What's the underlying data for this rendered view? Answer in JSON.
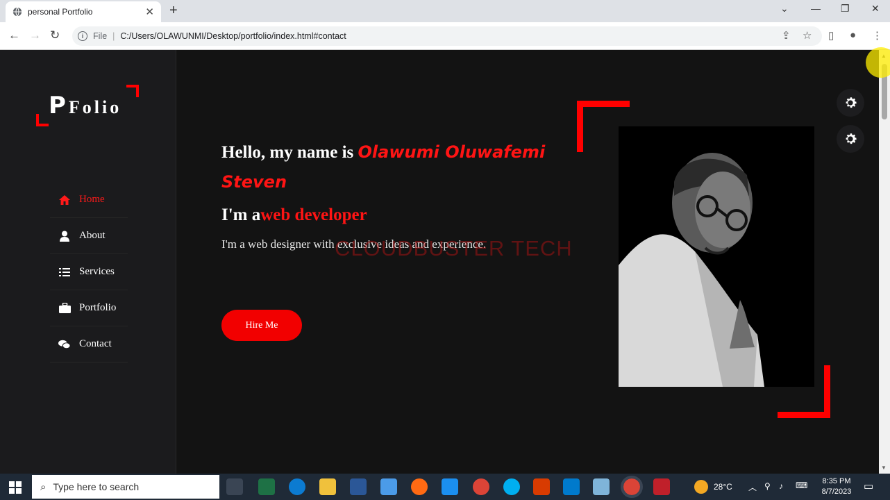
{
  "browser": {
    "tab_title": "personal Portfolio",
    "new_tab": "+",
    "address_scheme": "File",
    "address_url": "C:/Users/OLAWUNMI/Desktop/portfolio/index.html#contact"
  },
  "logo": {
    "initial": "P",
    "rest": "Folio"
  },
  "nav": [
    {
      "label": "Home",
      "icon": "home-icon",
      "active": true
    },
    {
      "label": "About",
      "icon": "user-icon",
      "active": false
    },
    {
      "label": "Services",
      "icon": "list-icon",
      "active": false
    },
    {
      "label": "Portfolio",
      "icon": "briefcase-icon",
      "active": false
    },
    {
      "label": "Contact",
      "icon": "comments-icon",
      "active": false
    }
  ],
  "hero": {
    "greeting_prefix": "Hello, my name is ",
    "name": "Olawumi Oluwafemi Steven",
    "role_prefix": "I'm a",
    "role": "web developer",
    "description": "I'm a web designer with exclusive ideas and experience.",
    "cta": "Hire Me"
  },
  "watermark": "CLOUDBUSTER TECH",
  "taskbar": {
    "search_placeholder": "Type here to search",
    "weather": "28°C",
    "time": "8:35 PM",
    "date": "8/7/2023"
  },
  "colors": {
    "accent": "#ff0000",
    "background": "#131313",
    "sidebar": "#1b1b1d"
  }
}
